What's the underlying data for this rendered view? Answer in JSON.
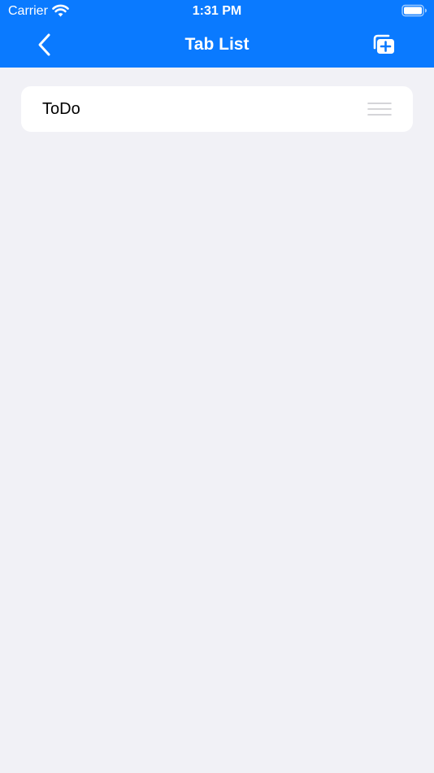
{
  "status_bar": {
    "carrier": "Carrier",
    "time": "1:31 PM",
    "wifi_icon": "wifi-icon",
    "battery_icon": "battery-icon"
  },
  "nav": {
    "title": "Tab List",
    "back_icon": "chevron-left-icon",
    "add_icon": "add-tab-icon"
  },
  "list": {
    "items": [
      {
        "label": "ToDo",
        "handle_icon": "reorder-handle-icon"
      }
    ]
  },
  "colors": {
    "accent": "#0a7aff",
    "background": "#f1f1f6",
    "card": "#ffffff",
    "handle": "#c7c7cc"
  }
}
